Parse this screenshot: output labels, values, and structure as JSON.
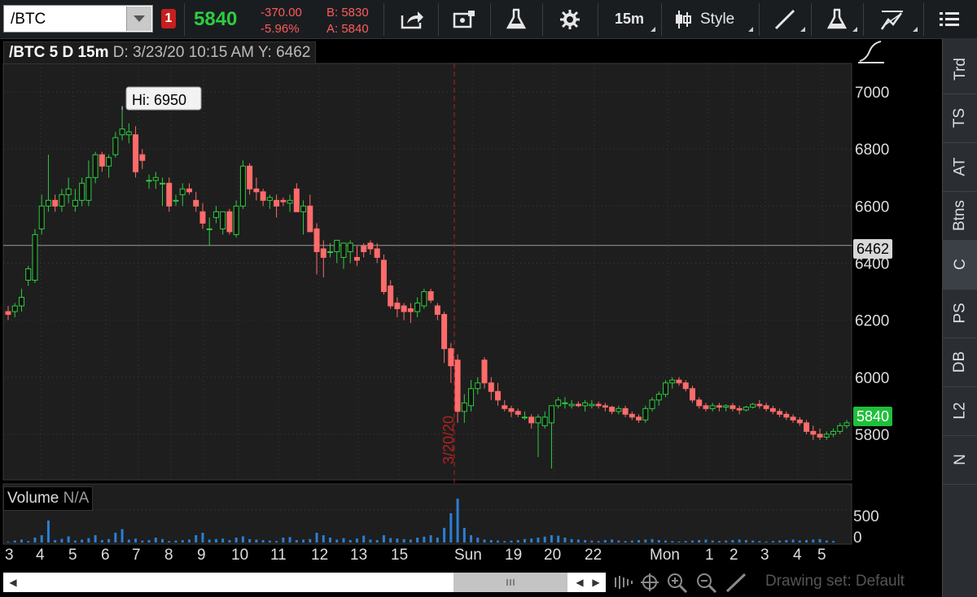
{
  "toolbar": {
    "symbol": "/BTC",
    "alert_badge": "1",
    "last_price": "5840",
    "net_change": "-370.00",
    "pct_change": "-5.96%",
    "bid": "B: 5830",
    "ask": "A: 5840",
    "interval": "15m",
    "style_label": "Style"
  },
  "header": {
    "title": "/BTC 5 D 15m",
    "date_readout": "D: 3/23/20 10:15 AM",
    "y_readout": "Y: 6462"
  },
  "price_axis": {
    "ticks": [
      "7000",
      "6800",
      "6600",
      "6400",
      "6200",
      "6000",
      "5800"
    ],
    "crosshair_tag": "6462",
    "last_tag": "5840"
  },
  "annotation": {
    "high_label": "Hi: 6950",
    "session_line_label": "3/20/20"
  },
  "volume": {
    "label": "Volume",
    "value": "N/A",
    "ticks": [
      "500",
      "0"
    ]
  },
  "x_axis": {
    "labels": [
      "3",
      "4",
      "5",
      "6",
      "7",
      "8",
      "9",
      "10",
      "11",
      "12",
      "13",
      "15",
      "Sun",
      "19",
      "20",
      "22",
      "Mon",
      "1",
      "2",
      "3",
      "4",
      "5"
    ]
  },
  "sidebar": {
    "items": [
      "Trd",
      "TS",
      "AT",
      "Btns",
      "C",
      "PS",
      "DB",
      "L2",
      "N"
    ]
  },
  "footer": {
    "drawing_set": "Drawing set: Default"
  },
  "colors": {
    "up": "#2ecc40",
    "down": "#ff6b6b",
    "vol": "#2a7fd4",
    "grid": "#3a3a3a"
  },
  "chart_data": {
    "type": "candlestick",
    "ylim": [
      5640,
      7100
    ],
    "candles": [
      [
        6230,
        6250,
        6200,
        6220
      ],
      [
        6230,
        6260,
        6210,
        6250
      ],
      [
        6250,
        6310,
        6230,
        6280
      ],
      [
        6340,
        6390,
        6320,
        6380
      ],
      [
        6340,
        6520,
        6330,
        6500
      ],
      [
        6520,
        6640,
        6500,
        6600
      ],
      [
        6600,
        6780,
        6580,
        6620
      ],
      [
        6620,
        6640,
        6580,
        6600
      ],
      [
        6600,
        6660,
        6580,
        6640
      ],
      [
        6640,
        6700,
        6610,
        6660
      ],
      [
        6600,
        6660,
        6580,
        6620
      ],
      [
        6620,
        6700,
        6600,
        6680
      ],
      [
        6620,
        6760,
        6600,
        6700
      ],
      [
        6700,
        6790,
        6680,
        6780
      ],
      [
        6780,
        6790,
        6720,
        6740
      ],
      [
        6740,
        6780,
        6700,
        6770
      ],
      [
        6780,
        6860,
        6770,
        6840
      ],
      [
        6850,
        6950,
        6830,
        6870
      ],
      [
        6850,
        6890,
        6820,
        6860
      ],
      [
        6850,
        6880,
        6700,
        6720
      ],
      [
        6780,
        6800,
        6730,
        6760
      ],
      [
        6690,
        6710,
        6660,
        6690
      ],
      [
        6690,
        6720,
        6660,
        6700
      ],
      [
        6680,
        6700,
        6600,
        6680
      ],
      [
        6680,
        6700,
        6580,
        6600
      ],
      [
        6620,
        6640,
        6600,
        6620
      ],
      [
        6640,
        6680,
        6600,
        6660
      ],
      [
        6660,
        6680,
        6640,
        6650
      ],
      [
        6620,
        6650,
        6580,
        6600
      ],
      [
        6580,
        6610,
        6520,
        6540
      ],
      [
        6520,
        6560,
        6460,
        6520
      ],
      [
        6560,
        6600,
        6540,
        6580
      ],
      [
        6520,
        6580,
        6500,
        6580
      ],
      [
        6580,
        6590,
        6500,
        6510
      ],
      [
        6500,
        6620,
        6490,
        6600
      ],
      [
        6600,
        6760,
        6590,
        6740
      ],
      [
        6740,
        6750,
        6640,
        6660
      ],
      [
        6660,
        6700,
        6620,
        6650
      ],
      [
        6650,
        6660,
        6600,
        6620
      ],
      [
        6620,
        6640,
        6590,
        6630
      ],
      [
        6620,
        6640,
        6560,
        6600
      ],
      [
        6620,
        6630,
        6600,
        6615
      ],
      [
        6610,
        6640,
        6580,
        6620
      ],
      [
        6660,
        6680,
        6600,
        6580
      ],
      [
        6580,
        6620,
        6500,
        6600
      ],
      [
        6600,
        6640,
        6580,
        6510
      ],
      [
        6520,
        6540,
        6360,
        6440
      ],
      [
        6450,
        6480,
        6350,
        6420
      ],
      [
        6440,
        6470,
        6420,
        6440
      ],
      [
        6440,
        6480,
        6400,
        6480
      ],
      [
        6420,
        6460,
        6380,
        6470
      ],
      [
        6440,
        6480,
        6400,
        6470
      ],
      [
        6420,
        6460,
        6390,
        6410
      ],
      [
        6460,
        6470,
        6420,
        6440
      ],
      [
        6470,
        6480,
        6430,
        6450
      ],
      [
        6450,
        6470,
        6400,
        6420
      ],
      [
        6410,
        6430,
        6290,
        6300
      ],
      [
        6320,
        6340,
        6240,
        6250
      ],
      [
        6260,
        6280,
        6210,
        6240
      ],
      [
        6250,
        6260,
        6200,
        6230
      ],
      [
        6240,
        6260,
        6190,
        6230
      ],
      [
        6230,
        6280,
        6210,
        6260
      ],
      [
        6250,
        6310,
        6240,
        6300
      ],
      [
        6300,
        6310,
        6260,
        6270
      ],
      [
        6250,
        6260,
        6200,
        6220
      ],
      [
        6220,
        6230,
        6050,
        6100
      ],
      [
        6100,
        6120,
        5980,
        6040
      ],
      [
        6060,
        6080,
        5840,
        5880
      ],
      [
        5880,
        5940,
        5840,
        5910
      ],
      [
        5900,
        5990,
        5880,
        5960
      ],
      [
        5960,
        6000,
        5940,
        5980
      ],
      [
        6060,
        6070,
        5960,
        5980
      ],
      [
        5980,
        6000,
        5920,
        5950
      ],
      [
        5950,
        5980,
        5900,
        5920
      ],
      [
        5900,
        5920,
        5880,
        5890
      ],
      [
        5890,
        5900,
        5860,
        5880
      ],
      [
        5880,
        5890,
        5860,
        5870
      ],
      [
        5860,
        5880,
        5850,
        5860
      ],
      [
        5860,
        5870,
        5820,
        5840
      ],
      [
        5840,
        5870,
        5720,
        5860
      ],
      [
        5830,
        5880,
        5820,
        5860
      ],
      [
        5840,
        5890,
        5680,
        5900
      ],
      [
        5900,
        5930,
        5890,
        5920
      ],
      [
        5910,
        5930,
        5890,
        5910
      ],
      [
        5900,
        5920,
        5890,
        5905
      ],
      [
        5905,
        5915,
        5895,
        5900
      ],
      [
        5900,
        5920,
        5880,
        5910
      ],
      [
        5900,
        5920,
        5890,
        5905
      ],
      [
        5905,
        5915,
        5890,
        5900
      ],
      [
        5900,
        5910,
        5880,
        5895
      ],
      [
        5895,
        5900,
        5870,
        5880
      ],
      [
        5880,
        5900,
        5870,
        5890
      ],
      [
        5890,
        5900,
        5860,
        5870
      ],
      [
        5870,
        5880,
        5850,
        5860
      ],
      [
        5860,
        5870,
        5840,
        5850
      ],
      [
        5850,
        5900,
        5840,
        5890
      ],
      [
        5890,
        5930,
        5880,
        5920
      ],
      [
        5920,
        5950,
        5900,
        5940
      ],
      [
        5940,
        5990,
        5930,
        5980
      ],
      [
        5980,
        6000,
        5960,
        5990
      ],
      [
        5990,
        6000,
        5970,
        5980
      ],
      [
        5980,
        5990,
        5950,
        5960
      ],
      [
        5960,
        5970,
        5910,
        5920
      ],
      [
        5920,
        5930,
        5890,
        5900
      ],
      [
        5900,
        5910,
        5880,
        5890
      ],
      [
        5890,
        5910,
        5880,
        5900
      ],
      [
        5900,
        5910,
        5880,
        5895
      ],
      [
        5895,
        5905,
        5880,
        5900
      ],
      [
        5900,
        5910,
        5880,
        5890
      ],
      [
        5890,
        5900,
        5870,
        5885
      ],
      [
        5885,
        5900,
        5880,
        5895
      ],
      [
        5895,
        5910,
        5890,
        5905
      ],
      [
        5905,
        5920,
        5890,
        5900
      ],
      [
        5900,
        5910,
        5880,
        5890
      ],
      [
        5890,
        5900,
        5870,
        5880
      ],
      [
        5880,
        5890,
        5860,
        5870
      ],
      [
        5870,
        5880,
        5850,
        5860
      ],
      [
        5860,
        5870,
        5840,
        5850
      ],
      [
        5850,
        5860,
        5830,
        5840
      ],
      [
        5840,
        5850,
        5800,
        5810
      ],
      [
        5810,
        5830,
        5780,
        5800
      ],
      [
        5800,
        5820,
        5780,
        5790
      ],
      [
        5790,
        5810,
        5780,
        5800
      ],
      [
        5800,
        5820,
        5790,
        5810
      ],
      [
        5810,
        5840,
        5800,
        5830
      ],
      [
        5830,
        5850,
        5820,
        5840
      ]
    ],
    "volumes": [
      3,
      8,
      12,
      6,
      20,
      30,
      90,
      10,
      15,
      25,
      8,
      12,
      18,
      30,
      10,
      14,
      40,
      55,
      12,
      16,
      8,
      10,
      20,
      14,
      6,
      8,
      10,
      12,
      30,
      40,
      12,
      14,
      16,
      10,
      20,
      25,
      14,
      12,
      10,
      8,
      6,
      20,
      22,
      10,
      12,
      14,
      40,
      30,
      20,
      12,
      18,
      10,
      16,
      28,
      12,
      10,
      30,
      18,
      16,
      14,
      12,
      20,
      24,
      30,
      20,
      60,
      120,
      180,
      60,
      30,
      20,
      12,
      10,
      8,
      6,
      8,
      10,
      14,
      16,
      20,
      24,
      30,
      28,
      20,
      14,
      12,
      10,
      8,
      6,
      10,
      12,
      8,
      6,
      8,
      10,
      12,
      14,
      10,
      8,
      6,
      4,
      6,
      8,
      10,
      12,
      8,
      6,
      8,
      10,
      12,
      10,
      8,
      6,
      4,
      6,
      8,
      10,
      12,
      8,
      10,
      12,
      14,
      8,
      6
    ]
  }
}
